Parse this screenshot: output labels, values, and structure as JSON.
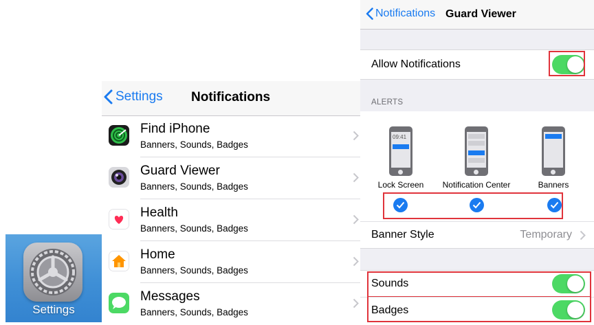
{
  "settings_icon": {
    "label": "Settings",
    "icon": "gear-icon"
  },
  "notifications_list": {
    "back_label": "Settings",
    "title": "Notifications",
    "apps": [
      {
        "name": "Find iPhone",
        "subtitle": "Banners, Sounds, Badges",
        "icon": "find-iphone-icon"
      },
      {
        "name": "Guard Viewer",
        "subtitle": "Banners, Sounds, Badges",
        "icon": "guard-viewer-icon"
      },
      {
        "name": "Health",
        "subtitle": "Banners, Sounds, Badges",
        "icon": "health-icon"
      },
      {
        "name": "Home",
        "subtitle": "Banners, Sounds, Badges",
        "icon": "home-icon"
      },
      {
        "name": "Messages",
        "subtitle": "Banners, Sounds, Badges",
        "icon": "messages-icon"
      }
    ]
  },
  "guard_viewer": {
    "back_label": "Notifications",
    "title": "Guard Viewer",
    "allow_notifications": {
      "label": "Allow Notifications",
      "on": true
    },
    "alerts_header": "ALERTS",
    "alert_styles": [
      {
        "label": "Lock Screen",
        "checked": true,
        "preview_time": "09:41"
      },
      {
        "label": "Notification Center",
        "checked": true
      },
      {
        "label": "Banners",
        "checked": true
      }
    ],
    "banner_style": {
      "label": "Banner Style",
      "value": "Temporary"
    },
    "sounds": {
      "label": "Sounds",
      "on": true
    },
    "badges": {
      "label": "Badges",
      "on": true
    }
  },
  "colors": {
    "accent": "#1a7bf0",
    "toggle_on": "#4cd964",
    "highlight": "#e0333b"
  }
}
